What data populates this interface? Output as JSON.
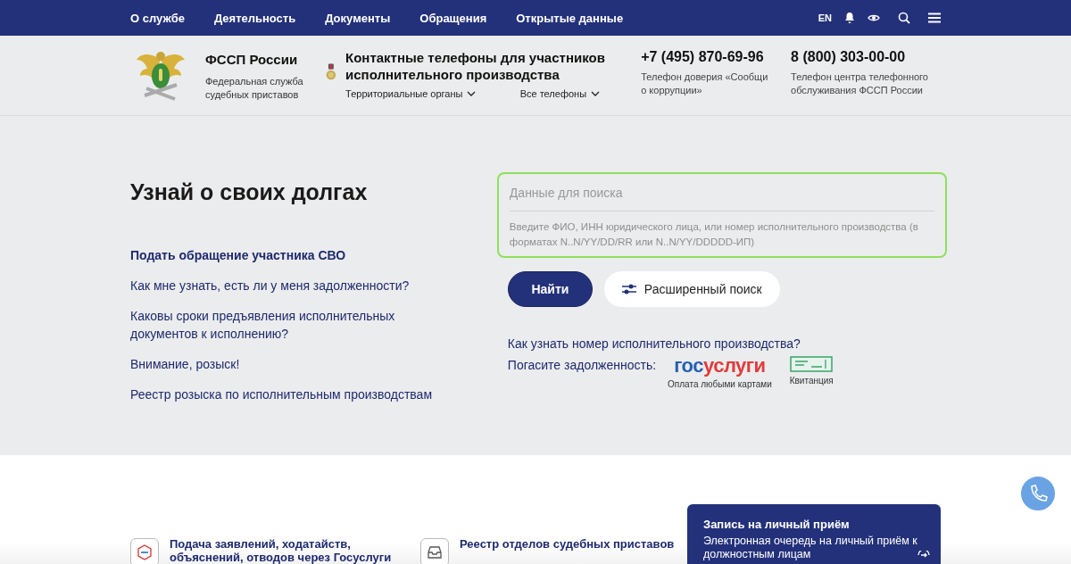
{
  "nav": {
    "items": [
      "О службе",
      "Деятельность",
      "Документы",
      "Обращения",
      "Открытые данные"
    ],
    "lang": "EN"
  },
  "header": {
    "org_name": "ФССП России",
    "org_subtitle": "Федеральная служба судебных приставов",
    "contact_title": "Контактные телефоны для участников исполнительного производства",
    "contact_links": [
      "Территориальные органы",
      "Все телефоны"
    ],
    "phones": [
      {
        "number": "+7 (495) 870-69-96",
        "caption": "Телефон доверия «Сообщи о коррупции»"
      },
      {
        "number": "8 (800) 303-00-00",
        "caption": "Телефон центра телефонного обслуживания ФССП России"
      }
    ]
  },
  "hero": {
    "title": "Узнай о своих долгах",
    "links": [
      {
        "text": "Подать обращение участника СВО",
        "emphasized": true
      },
      {
        "text": "Как мне узнать, есть ли у меня задолженности?",
        "emphasized": false
      },
      {
        "text": "Каковы сроки предъявления исполнительных документов к исполнению?",
        "emphasized": false
      },
      {
        "text": "Внимание, розыск!",
        "emphasized": false
      },
      {
        "text": "Реестр розыска по исполнительным производствам",
        "emphasized": false
      }
    ],
    "search": {
      "placeholder": "Данные для поиска",
      "hint": "Введите ФИО, ИНН юридического лица, или номер исполнительного производства (в форматах N..N/YY/DD/RR или N..N/YY/DDDDD-ИП)",
      "focused": true
    },
    "find_button": "Найти",
    "advanced_button": "Расширенный поиск",
    "help_link": "Как узнать номер исполнительного производства?",
    "pay_label": "Погасите задолженность:",
    "gosuslugi": {
      "part_1": "гос",
      "part_2": "услуги",
      "caption": "Оплата любыми картами"
    },
    "receipt_caption": "Квитанция"
  },
  "bottom": {
    "services": [
      "Подача заявлений, ходатайств, объяснений, отводов через Госуслуги",
      "Реестр отделов судебных приставов"
    ],
    "card": {
      "title": "Запись на личный приём",
      "text": "Электронная очередь на личный приём к должностным лицам"
    }
  }
}
